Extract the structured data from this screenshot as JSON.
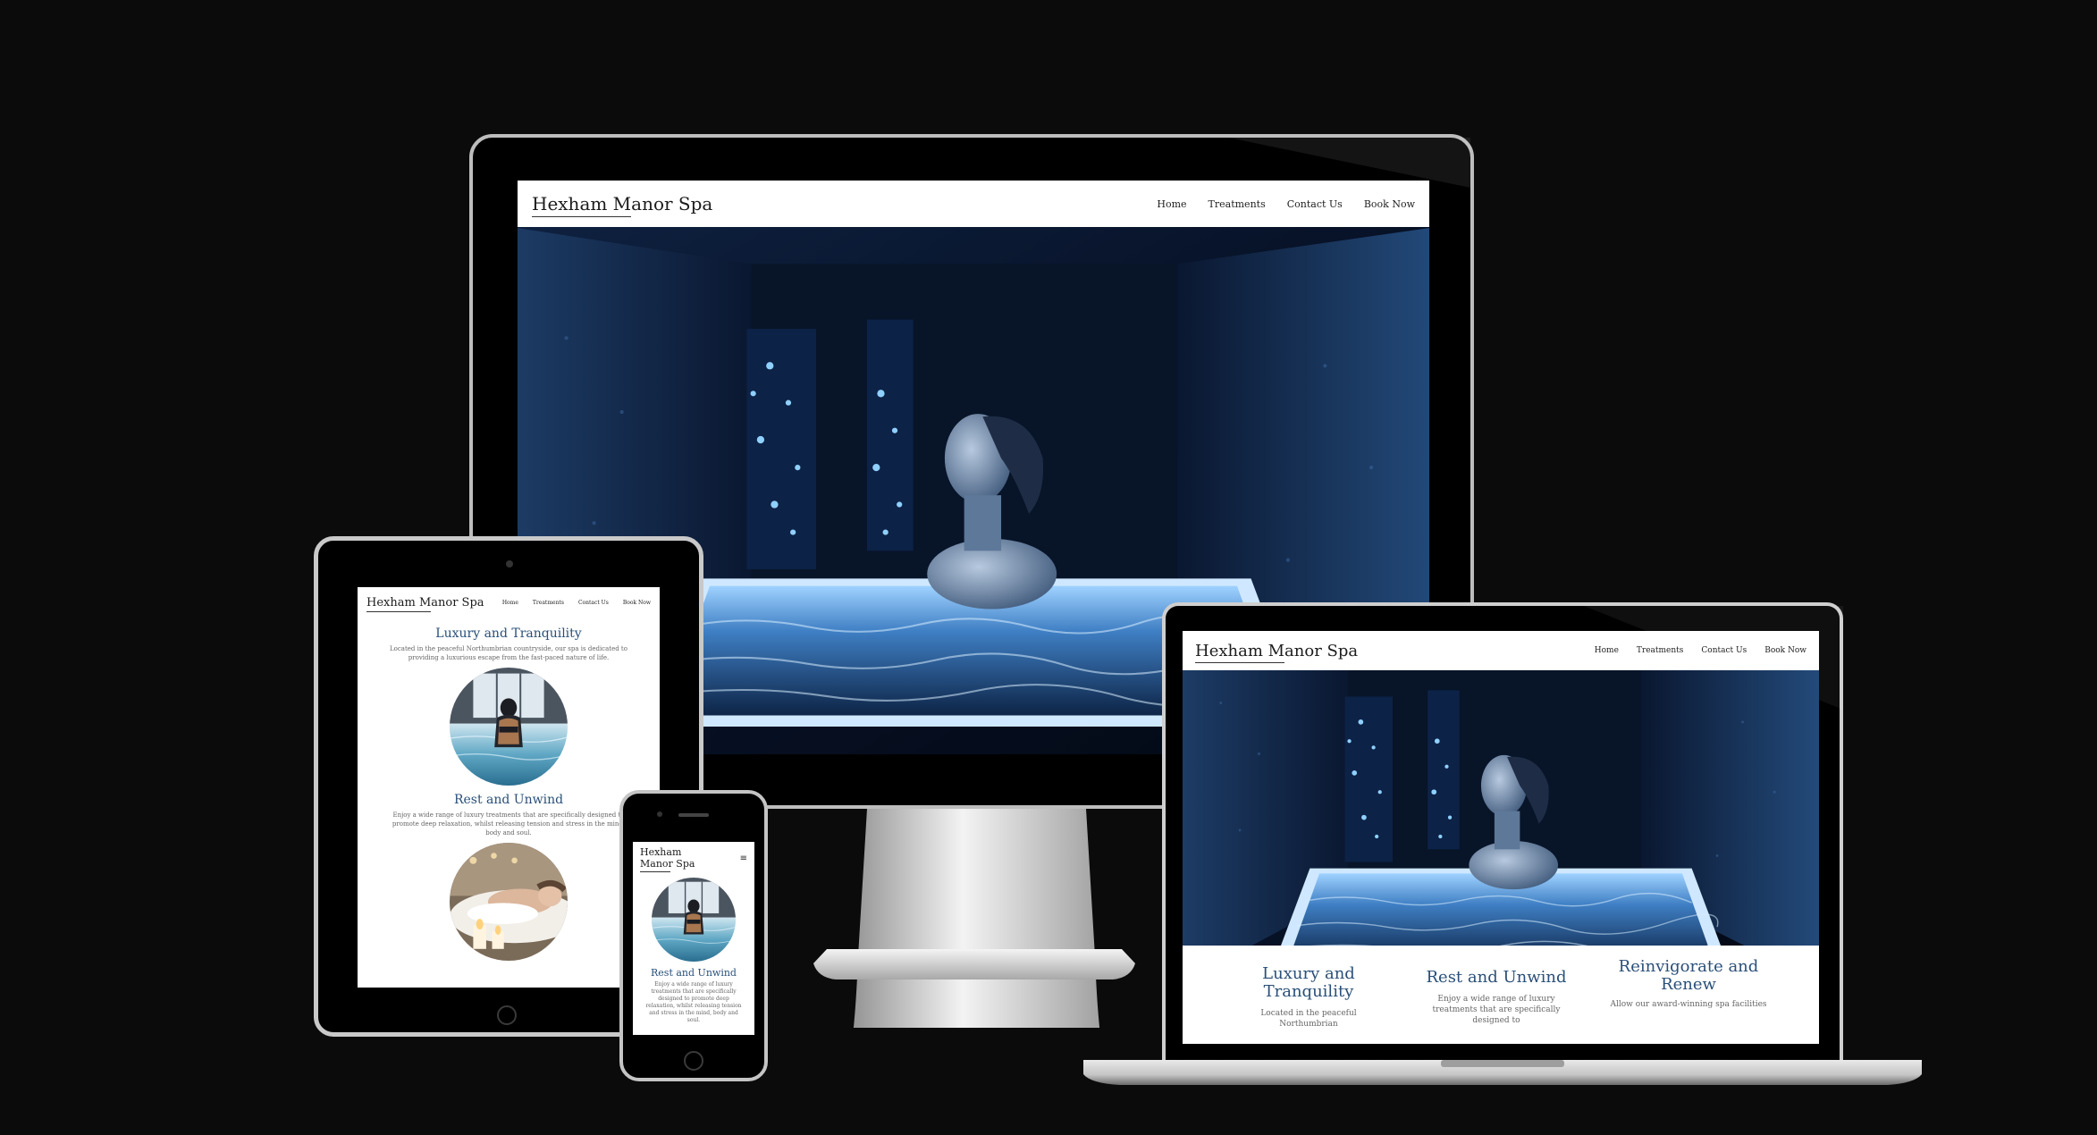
{
  "site": {
    "brand": "Hexham Manor Spa",
    "brand_line1": "Hexham",
    "brand_line2": "Manor Spa",
    "nav": [
      "Home",
      "Treatments",
      "Contact Us",
      "Book Now"
    ],
    "menu_icon": "≡"
  },
  "sections": {
    "luxury": {
      "title": "Luxury and Tranquility",
      "title_line1": "Luxury and",
      "title_line2": "Tranquility",
      "text": "Located in the peaceful Northumbrian countryside, our spa is dedicated to providing a luxurious escape from the fast-paced nature of life.",
      "text_laptop": "Located in the peaceful Northumbrian"
    },
    "rest": {
      "title": "Rest and Unwind",
      "text_tablet": "Enjoy a wide range of luxury treatments that are specifically designed to promote deep relaxation, whilst releasing tension and stress in the mind, body and soul.",
      "text_phone": "Enjoy a wide range of luxury treatments that are specifically designed to promote deep relaxation, whilst releasing tension and stress in the mind, body and soul.",
      "text_laptop": "Enjoy a wide range of luxury treatments that are specifically designed to"
    },
    "renew": {
      "title": "Reinvigorate and Renew",
      "title_line1": "Reinvigorate and",
      "title_line2": "Renew",
      "text_laptop": "Allow our award-winning spa facilities"
    }
  },
  "icons": {
    "hero": "spa-pool-woman-image",
    "pool_circle": "pool-woman-circle-image",
    "massage_circle": "massage-candles-circle-image"
  },
  "colors": {
    "background": "#0b0b0c",
    "heading_blue": "#2a4f78",
    "hero_deep": "#0a1a33",
    "hero_glow": "#5aa9ff"
  }
}
